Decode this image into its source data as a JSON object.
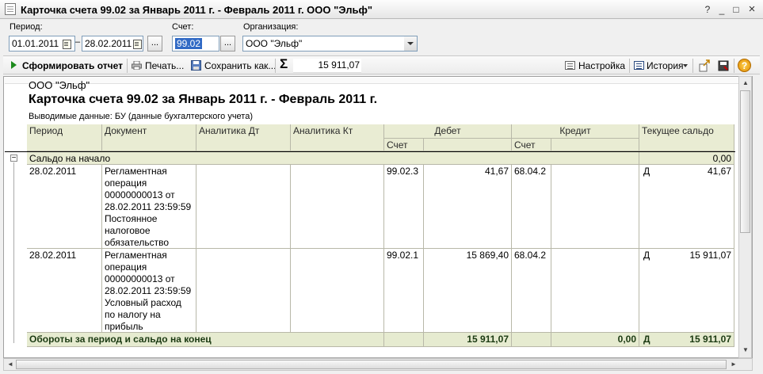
{
  "window": {
    "title": "Карточка счета 99.02 за Январь 2011 г. - Февраль 2011 г. ООО \"Эльф\"",
    "btn_help": "?",
    "btn_min": "_",
    "btn_max": "□",
    "btn_close": "×"
  },
  "filters": {
    "period_label": "Период:",
    "period_from": "01.01.2011",
    "period_dash": "–",
    "period_to": "28.02.2011",
    "period_select": "...",
    "account_label": "Счет:",
    "account_value": "99.02",
    "account_select": "...",
    "org_label": "Организация:",
    "org_value": "ООО \"Эльф\""
  },
  "toolbar": {
    "generate": "Сформировать отчет",
    "print": "Печать...",
    "save": "Сохранить как...",
    "sigma": "Σ",
    "sum": "15 911,07",
    "settings": "Настройка",
    "history": "История",
    "help": "?"
  },
  "report": {
    "org": "ООО \"Эльф\"",
    "title": "Карточка счета 99.02 за Январь 2011 г. - Февраль 2011 г.",
    "output_data": "Выводимые данные:  БУ (данные бухгалтерского учета)",
    "headers": {
      "period": "Период",
      "document": "Документ",
      "an_dt": "Аналитика Дт",
      "an_kt": "Аналитика Кт",
      "debit": "Дебет",
      "credit": "Кредит",
      "balance": "Текущее сальдо",
      "debit_acc": "Счет",
      "credit_acc": "Счет"
    },
    "opening_label": "Сальдо на начало",
    "opening_value": "0,00",
    "rows": [
      {
        "date": "28.02.2011",
        "doc": [
          "Регламентная",
          "операция",
          "00000000013 от",
          "28.02.2011 23:59:59",
          "Постоянное",
          "налоговое",
          "обязательство"
        ],
        "dt_acc": "99.02.3",
        "dt_sum": "41,67",
        "kt_acc": "68.04.2",
        "bal_side": "Д",
        "bal_sum": "41,67"
      },
      {
        "date": "28.02.2011",
        "doc": [
          "Регламентная",
          "операция",
          "00000000013 от",
          "28.02.2011 23:59:59",
          "Условный расход",
          "по налогу на",
          "прибыль"
        ],
        "dt_acc": "99.02.1",
        "dt_sum": "15 869,40",
        "kt_acc": "68.04.2",
        "bal_side": "Д",
        "bal_sum": "15 911,07"
      }
    ],
    "totals": {
      "label": "Обороты за период и сальдо на конец",
      "debit": "15 911,07",
      "credit": "0,00",
      "side": "Д",
      "balance": "15 911,07"
    },
    "collapse": "−"
  },
  "scroll": {
    "up": "▲",
    "down": "▼",
    "left": "◄",
    "right": "►"
  }
}
